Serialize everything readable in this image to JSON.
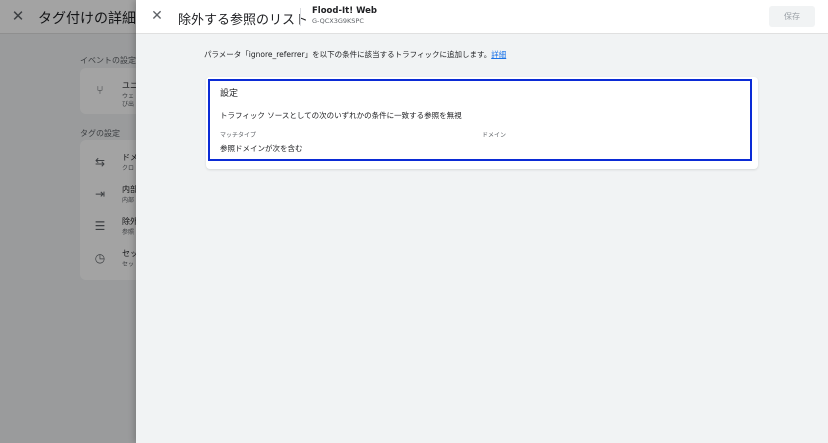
{
  "background_page": {
    "title": "タグ付けの詳細設定",
    "event_section_label": "イベントの設定",
    "tag_section_label": "タグの設定",
    "event_item": {
      "title": "ユニ",
      "sub1": "ウェ",
      "sub2": "び出"
    },
    "tag_items": [
      {
        "title": "ドメ",
        "sub": "クロ",
        "icon": "merge-arrows-icon"
      },
      {
        "title": "内部",
        "sub": "内部",
        "icon": "enter-box-icon"
      },
      {
        "title": "除外",
        "sub": "参照",
        "icon": "list-remove-icon"
      },
      {
        "title": "セッ",
        "sub": "セッ",
        "icon": "clock-icon"
      }
    ]
  },
  "panel": {
    "title": "除外する参照のリスト",
    "stream_name": "Flood-It! Web",
    "stream_id": "G-QCX3G9KSPC",
    "save_label": "保存",
    "description": "パラメータ「ignore_referrer」を以下の条件に該当するトラフィックに追加します。",
    "description_link": "詳細",
    "card": {
      "title": "設定",
      "condition": "トラフィック ソースとしての次のいずれかの条件に一致する参照を無視",
      "column_match_type": "マッチタイプ",
      "column_domain": "ドメイン",
      "match_type_value": "参照ドメインが次を含む"
    }
  },
  "colors": {
    "highlight_border": "#0b2bd6",
    "link": "#1a73e8",
    "panel_bg": "#f1f3f4"
  }
}
